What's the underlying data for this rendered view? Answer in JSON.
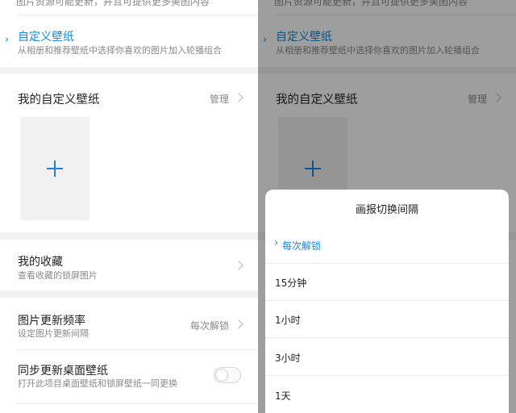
{
  "top_partial_text": "图片资源可能更新，并且可提供更多美图内容",
  "custom_wallpaper": {
    "title": "自定义壁纸",
    "subtitle": "从相册和推荐壁纸中选择你喜欢的图片加入轮播组合"
  },
  "my_custom": {
    "title": "我的自定义壁纸",
    "manage": "管理"
  },
  "favorites": {
    "title": "我的收藏",
    "subtitle": "查看收藏的锁屏图片"
  },
  "update_freq": {
    "title": "图片更新频率",
    "subtitle": "设定图片更新间隔",
    "value": "每次解锁"
  },
  "sync_desktop": {
    "title": "同步更新桌面壁纸",
    "subtitle": "打开此项目桌面壁纸和锁屏壁纸一同更换",
    "enabled": false
  },
  "sheet": {
    "title": "画报切换间隔",
    "options": [
      "每次解锁",
      "15分钟",
      "1小时",
      "3小时",
      "1天"
    ],
    "selected": "每次解锁"
  },
  "colors": {
    "accent": "#1a86d6",
    "overlay": "rgba(0,0,0,0.38)",
    "section_gap": "#f2f2f2"
  },
  "icons": {
    "chevron": "chevron-right-icon",
    "add": "plus-icon",
    "selected_marker": "caret-right-icon"
  }
}
